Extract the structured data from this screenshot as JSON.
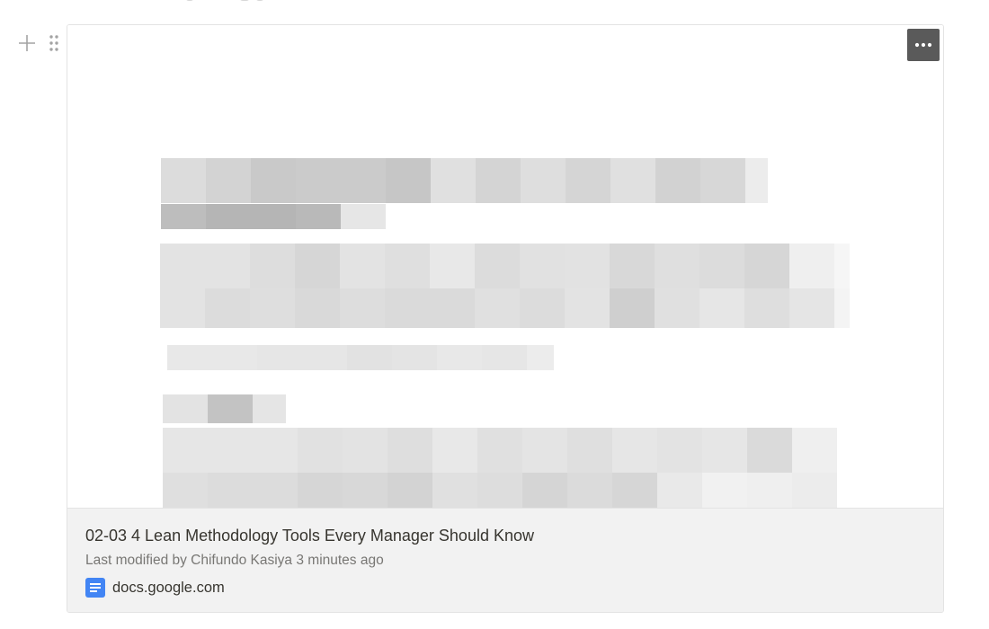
{
  "bookmark": {
    "title": "02-03 4 Lean Methodology Tools Every Manager Should Know",
    "last_modified": "Last modified by Chifundo Kasiya 3 minutes ago",
    "domain": "docs.google.com",
    "source_icon": "google-docs-icon",
    "preview": "pixelated-document-preview"
  },
  "block_handles": {
    "add_icon": "plus-icon",
    "drag_icon": "drag-dots-icon"
  },
  "card_actions": {
    "more_icon": "ellipsis-icon"
  },
  "colors": {
    "meta_background": "#f2f2f2",
    "more_button": "#5a5a5a",
    "google_docs_blue": "#4285f4",
    "text_primary": "#37352f",
    "text_secondary": "#787774"
  }
}
